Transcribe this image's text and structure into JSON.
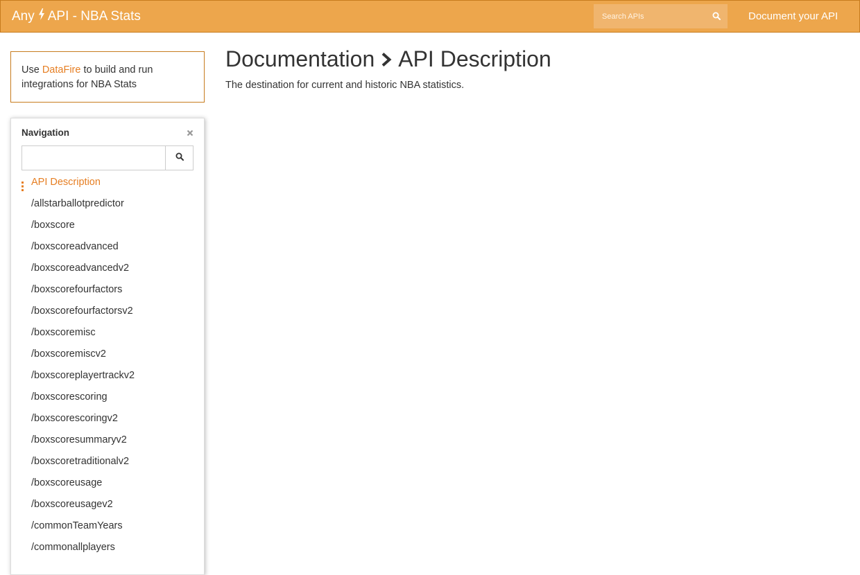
{
  "header": {
    "brand_prefix": "Any",
    "brand_suffix": "API - NBA Stats",
    "search_placeholder": "Search APIs",
    "doc_link": "Document your API",
    "brand_color": "#eda64c",
    "accent_color": "#e67e22"
  },
  "promo": {
    "prefix": "Use",
    "link": "DataFire",
    "suffix": "to build and run integrations for NBA Stats"
  },
  "navigation": {
    "title": "Navigation",
    "search_value": "",
    "items": [
      {
        "label": "API Description",
        "active": true
      },
      {
        "label": "/allstarballotpredictor"
      },
      {
        "label": "/boxscore"
      },
      {
        "label": "/boxscoreadvanced"
      },
      {
        "label": "/boxscoreadvancedv2"
      },
      {
        "label": "/boxscorefourfactors"
      },
      {
        "label": "/boxscorefourfactorsv2"
      },
      {
        "label": "/boxscoremisc"
      },
      {
        "label": "/boxscoremiscv2"
      },
      {
        "label": "/boxscoreplayertrackv2"
      },
      {
        "label": "/boxscorescoring"
      },
      {
        "label": "/boxscorescoringv2"
      },
      {
        "label": "/boxscoresummaryv2"
      },
      {
        "label": "/boxscoretraditionalv2"
      },
      {
        "label": "/boxscoreusage"
      },
      {
        "label": "/boxscoreusagev2"
      },
      {
        "label": "/commonTeamYears"
      },
      {
        "label": "/commonallplayers"
      }
    ]
  },
  "main": {
    "breadcrumb_parent": "Documentation",
    "breadcrumb_current": "API Description",
    "description": "The destination for current and historic NBA statistics."
  }
}
